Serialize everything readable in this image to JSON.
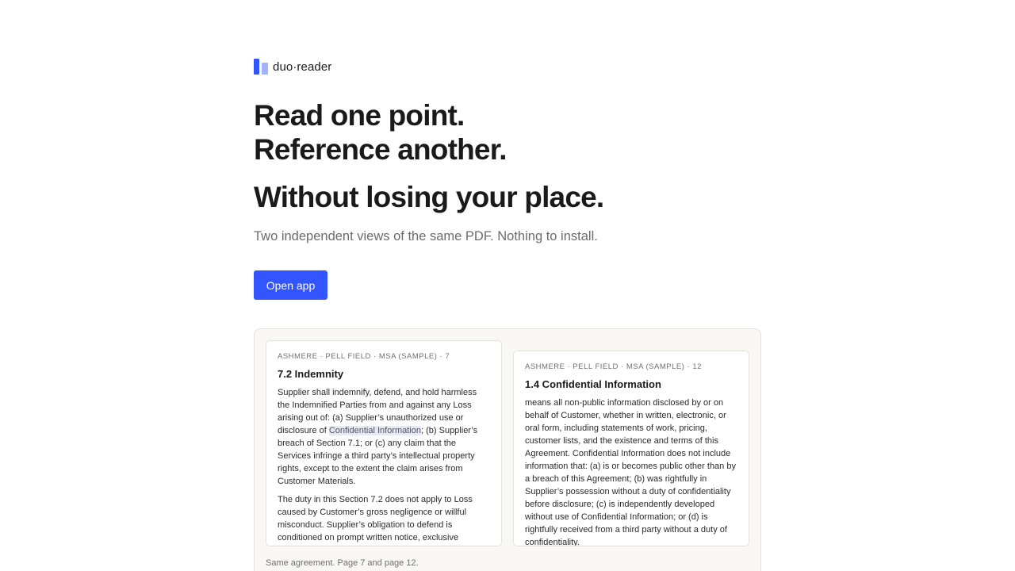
{
  "brand": {
    "name": "duo·reader",
    "icon": "split-panes-logo-icon",
    "accent": "#3355ff",
    "accent_light": "#a3b2ff"
  },
  "hero": {
    "line1": "Read one point.",
    "line2": "Reference another.",
    "line3": "Without losing your place.",
    "subtitle": "Two independent views of the same PDF. Nothing to install.",
    "cta_label": "Open app"
  },
  "demo": {
    "left_pane": {
      "meta": "ASHMERE · PELL FIELD · MSA (SAMPLE) · 7",
      "title": "7.2 Indemnity",
      "para1_before": "Supplier shall indemnify, defend, and hold harmless the Indemnified Parties from and against any Loss arising out of: (a) Supplier’s unauthorized use or disclosure of ",
      "para1_highlight": "Confidential Information",
      "para1_after": "; (b) Supplier’s breach of Section 7.1; or (c) any claim that the Services infringe a third party’s intellectual property rights, except to the extent the claim arises from Customer Materials.",
      "para2": "The duty in this Section 7.2 does not apply to Loss caused by Customer’s gross negligence or willful misconduct. Supplier’s obligation to defend is conditioned on prompt written notice, exclusive"
    },
    "right_pane": {
      "meta": "ASHMERE · PELL FIELD · MSA (SAMPLE) · 12",
      "title": "1.4 Confidential Information",
      "para1": "means all non-public information disclosed by or on behalf of Customer, whether in written, electronic, or oral form, including statements of work, pricing, customer lists, and the existence and terms of this Agreement. Confidential Information does not include information that: (a) is or becomes public other than by a breach of this Agreement; (b) was rightfully in Supplier’s possession without a duty of confidentiality before disclosure; (c) is independently developed without use of Confidential Information; or (d) is rightfully received from a third party without a duty of confidentiality."
    },
    "caption": "Same agreement. Page 7 and page 12."
  }
}
